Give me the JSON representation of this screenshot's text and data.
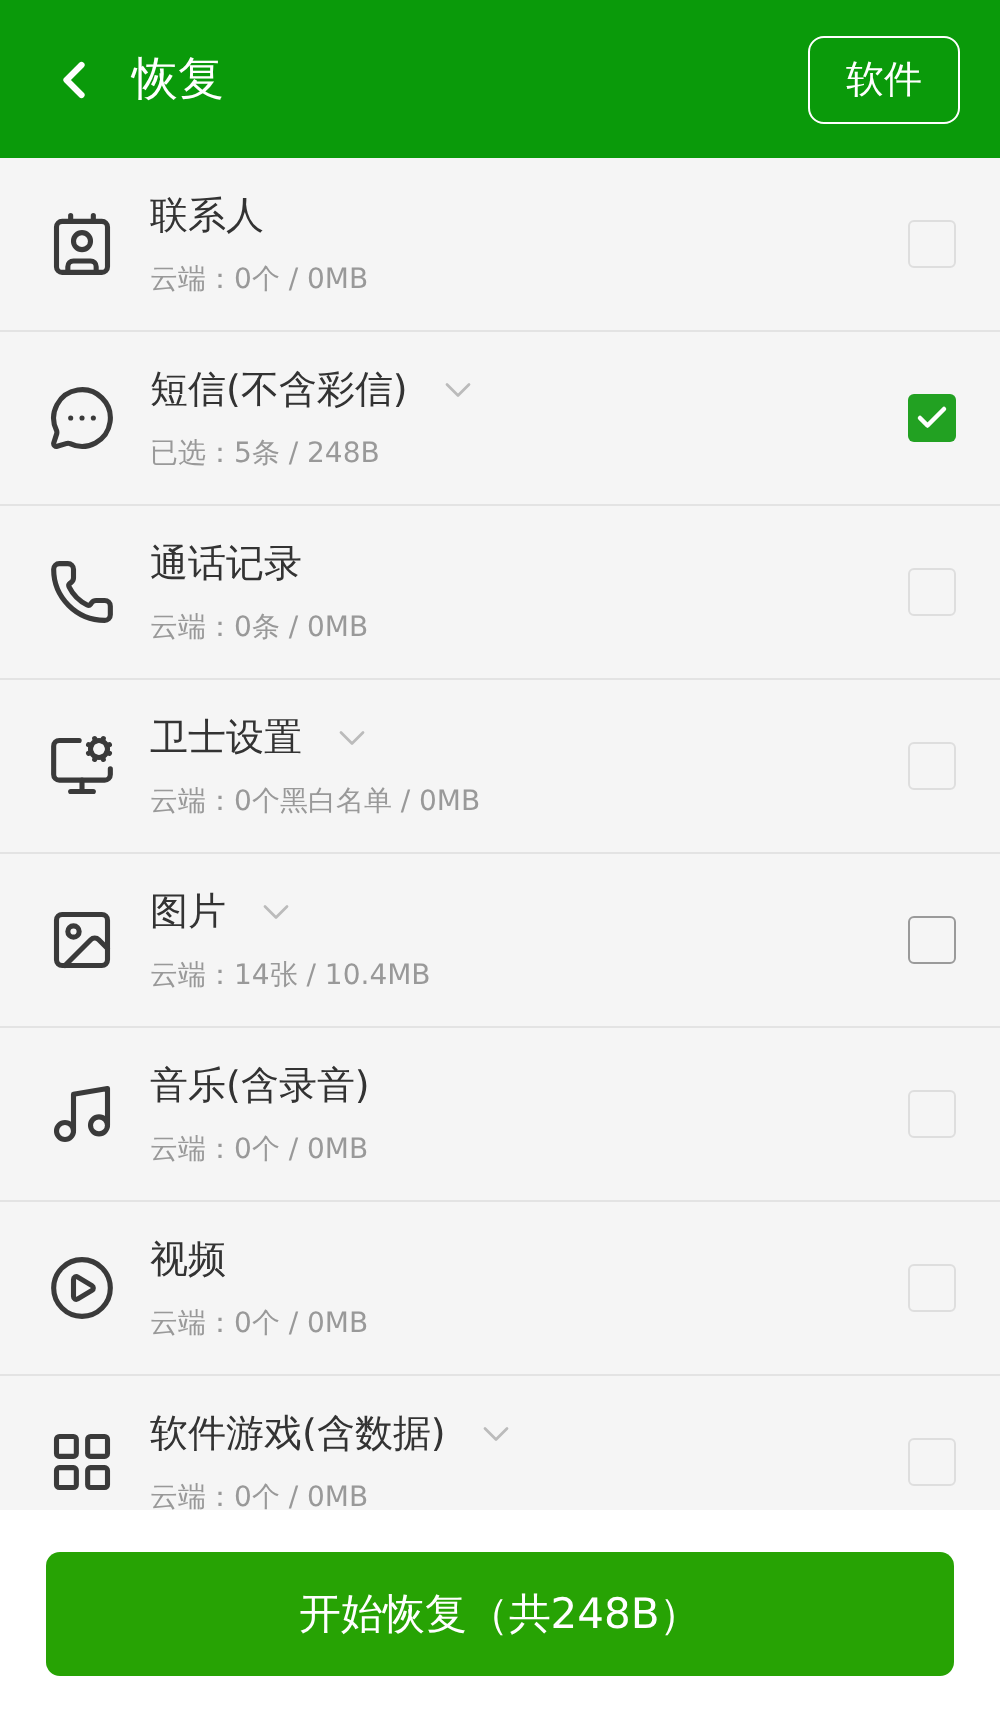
{
  "header": {
    "title": "恢复",
    "action": "软件"
  },
  "items": [
    {
      "name": "联系人",
      "detail": "云端：0个 / 0MB",
      "expandable": false,
      "checked": false,
      "disabled": true
    },
    {
      "name": "短信(不含彩信)",
      "detail": "已选：5条 / 248B",
      "expandable": true,
      "checked": true,
      "disabled": false
    },
    {
      "name": "通话记录",
      "detail": "云端：0条 / 0MB",
      "expandable": false,
      "checked": false,
      "disabled": true
    },
    {
      "name": "卫士设置",
      "detail": "云端：0个黑白名单 / 0MB",
      "expandable": true,
      "checked": false,
      "disabled": true
    },
    {
      "name": "图片",
      "detail": "云端：14张 / 10.4MB",
      "expandable": true,
      "checked": false,
      "disabled": false
    },
    {
      "name": "音乐(含录音)",
      "detail": "云端：0个 / 0MB",
      "expandable": false,
      "checked": false,
      "disabled": true
    },
    {
      "name": "视频",
      "detail": "云端：0个 / 0MB",
      "expandable": false,
      "checked": false,
      "disabled": true
    },
    {
      "name": "软件游戏(含数据)",
      "detail": "云端：0个 / 0MB",
      "expandable": true,
      "checked": false,
      "disabled": true
    }
  ],
  "start_button": "开始恢复（共248B）"
}
